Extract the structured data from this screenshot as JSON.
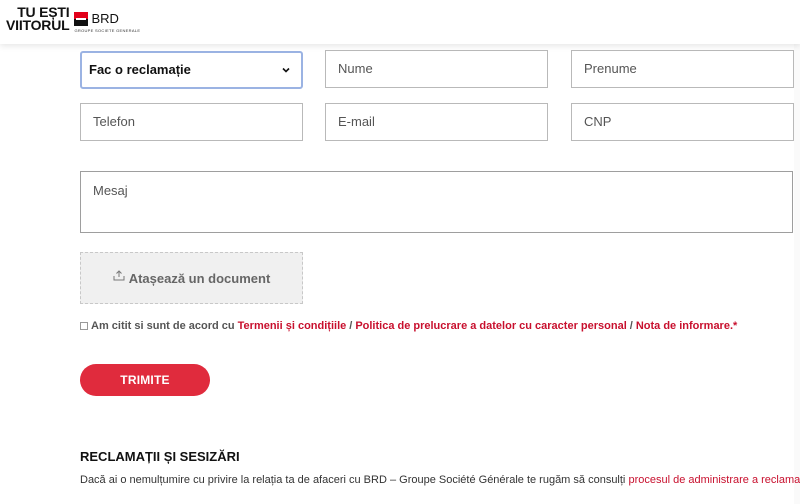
{
  "header": {
    "slogan_line1": "TU EȘTI",
    "slogan_line2": "VIITORUL",
    "brand_name": "BRD",
    "brand_sub": "GROUPE SOCIETE GENERALE"
  },
  "form": {
    "request_type": {
      "selected": "Fac o reclamație"
    },
    "fields": {
      "nume": "Nume",
      "prenume": "Prenume",
      "telefon": "Telefon",
      "email": "E-mail",
      "cnp": "CNP",
      "mesaj": "Mesaj"
    },
    "attach_label": "Atașează un document",
    "agree": {
      "prefix": "Am citit si sunt de acord cu",
      "terms": "Termenii și condițiile",
      "privacy": "Politica de prelucrare a datelor cu caracter personal",
      "info": "Nota de informare.",
      "required_mark": "*",
      "separator": "/"
    },
    "submit_label": "TRIMITE"
  },
  "complaints": {
    "title": "RECLAMAȚII ȘI SESIZĂRI",
    "text": "Dacă ai o nemulțumire cu privire la relația ta de afaceri cu BRD – Groupe Société Générale te rugăm să consulți",
    "link": "procesul de administrare a reclamațiilor",
    "suffix": ".."
  },
  "colors": {
    "accent_red": "#e02b3d",
    "link_red": "#c8102e",
    "focus_blue": "#9bb3e3"
  }
}
